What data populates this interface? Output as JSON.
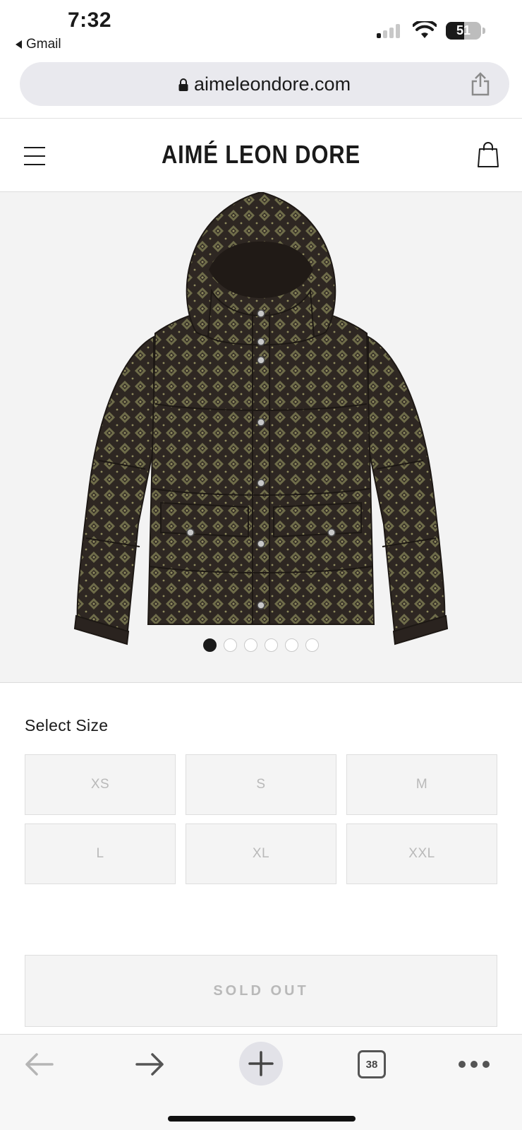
{
  "status_bar": {
    "time": "7:32",
    "back_app": "Gmail",
    "battery_percent": "51",
    "battery_level": 0.51,
    "icons": [
      "signal-icon",
      "wifi-icon",
      "battery-icon"
    ]
  },
  "browser": {
    "url": "aimeleondore.com",
    "icons": [
      "lock-icon",
      "share-icon"
    ]
  },
  "site": {
    "brand": "AIMÉ LEON DORE",
    "icons": [
      "menu-icon",
      "shopping-bag-icon"
    ]
  },
  "product": {
    "image_icon": "jacket-image",
    "carousel": {
      "count": 6,
      "active_index": 0
    }
  },
  "size_section": {
    "title": "Select Size",
    "options": [
      "XS",
      "S",
      "M",
      "L",
      "XL",
      "XXL"
    ]
  },
  "cta": {
    "label": "SOLD OUT"
  },
  "toolbar": {
    "tabs_count": "38",
    "icons": [
      "back-arrow-icon",
      "forward-arrow-icon",
      "plus-icon",
      "tabs-icon",
      "more-icon"
    ]
  },
  "colors": {
    "jacket_base": "#2e2722",
    "jacket_pattern": "#6f6d4a",
    "disabled_text": "#b9b9b9",
    "panel_bg": "#f3f3f3"
  }
}
